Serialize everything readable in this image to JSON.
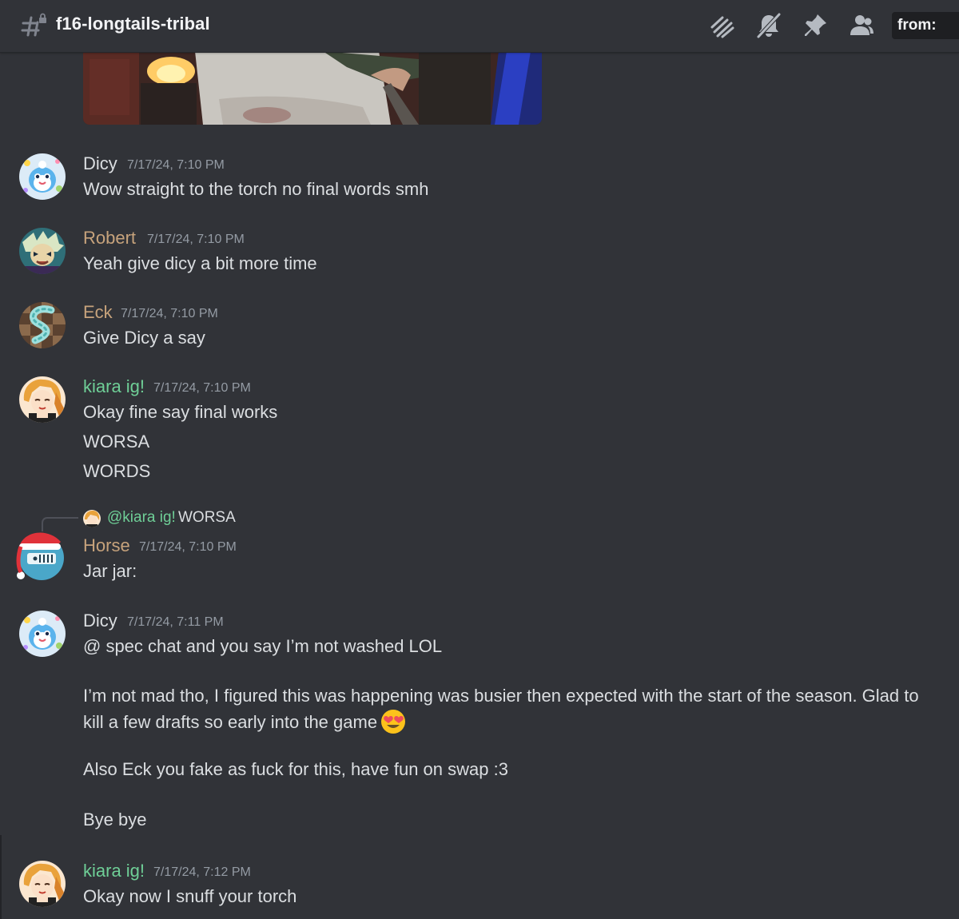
{
  "channel": {
    "name": "f16-longtails-tribal"
  },
  "header": {
    "icons": [
      "threads-icon",
      "mute-bell-icon",
      "pin-icon",
      "members-icon"
    ],
    "search_prefix": "from:"
  },
  "messages": [
    {
      "user": "Dicy",
      "color": "#dbdee1",
      "timestamp": "7/17/24, 7:10 PM",
      "lines": [
        "Wow straight to the torch no final words smh"
      ]
    },
    {
      "user": "Robert",
      "color": "#c7a37c",
      "timestamp": "7/17/24, 7:10 PM",
      "lines": [
        "Yeah give dicy a bit more time"
      ]
    },
    {
      "user": "Eck",
      "color": "#c7a37c",
      "timestamp": "7/17/24, 7:10 PM",
      "lines": [
        "Give Dicy a say"
      ]
    },
    {
      "user": "kiara ig!",
      "color": "#6fcf97",
      "timestamp": "7/17/24, 7:10 PM",
      "lines": [
        "Okay fine say final works",
        "WORSA",
        "WORDS"
      ]
    },
    {
      "reply": {
        "mention": "@kiara ig!",
        "text": "WORSA"
      },
      "user": "Horse",
      "color": "#c7a37c",
      "timestamp": "7/17/24, 7:10 PM",
      "lines": [
        "Jar jar:"
      ]
    },
    {
      "user": "Dicy",
      "color": "#dbdee1",
      "timestamp": "7/17/24, 7:11 PM",
      "lines": [
        "@ spec chat and you say I’m not washed LOL",
        "I’m not mad tho, I figured this was happening was busier then expected with the start of the season. Glad to kill a few drafts so early into the game",
        "Also Eck you fake as fuck for this, have fun on swap :3",
        "Bye bye"
      ],
      "emoji": "heart-eyes-emoji"
    },
    {
      "user": "kiara ig!",
      "color": "#6fcf97",
      "timestamp": "7/17/24, 7:12 PM",
      "lines": [
        "Okay now I snuff your torch"
      ]
    }
  ]
}
